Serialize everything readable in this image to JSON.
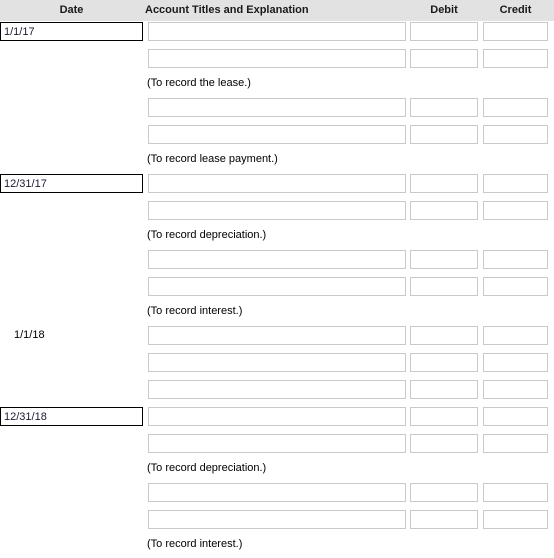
{
  "header": {
    "columns": [
      {
        "key": "date",
        "label": "Date"
      },
      {
        "key": "account",
        "label": "Account Titles and Explanation"
      },
      {
        "key": "debit",
        "label": "Debit"
      },
      {
        "key": "credit",
        "label": "Credit"
      }
    ],
    "background_color": "#e2e2e2"
  },
  "rows": [
    {
      "type": "entry",
      "date": "1/1/17",
      "date_style": "boxed",
      "account": "",
      "debit": "",
      "credit": ""
    },
    {
      "type": "entry",
      "date": "",
      "date_style": "none",
      "account": "",
      "debit": "",
      "credit": ""
    },
    {
      "type": "caption",
      "text": "(To record the lease.)"
    },
    {
      "type": "entry",
      "date": "",
      "date_style": "none",
      "account": "",
      "debit": "",
      "credit": ""
    },
    {
      "type": "entry",
      "date": "",
      "date_style": "none",
      "account": "",
      "debit": "",
      "credit": ""
    },
    {
      "type": "caption",
      "text": "(To record lease payment.)"
    },
    {
      "type": "entry",
      "date": "12/31/17",
      "date_style": "boxed",
      "account": "",
      "debit": "",
      "credit": ""
    },
    {
      "type": "entry",
      "date": "",
      "date_style": "none",
      "account": "",
      "debit": "",
      "credit": ""
    },
    {
      "type": "caption",
      "text": "(To record depreciation.)"
    },
    {
      "type": "entry",
      "date": "",
      "date_style": "none",
      "account": "",
      "debit": "",
      "credit": ""
    },
    {
      "type": "entry",
      "date": "",
      "date_style": "none",
      "account": "",
      "debit": "",
      "credit": ""
    },
    {
      "type": "caption",
      "text": "(To record interest.)"
    },
    {
      "type": "entry",
      "date": "1/1/18",
      "date_style": "plain",
      "account": "",
      "debit": "",
      "credit": ""
    },
    {
      "type": "entry",
      "date": "",
      "date_style": "none",
      "account": "",
      "debit": "",
      "credit": ""
    },
    {
      "type": "entry",
      "date": "",
      "date_style": "none",
      "account": "",
      "debit": "",
      "credit": ""
    },
    {
      "type": "entry",
      "date": "12/31/18",
      "date_style": "boxed",
      "account": "",
      "debit": "",
      "credit": ""
    },
    {
      "type": "entry",
      "date": "",
      "date_style": "none",
      "account": "",
      "debit": "",
      "credit": ""
    },
    {
      "type": "caption",
      "text": "(To record depreciation.)"
    },
    {
      "type": "entry",
      "date": "",
      "date_style": "none",
      "account": "",
      "debit": "",
      "credit": ""
    },
    {
      "type": "entry",
      "date": "",
      "date_style": "none",
      "account": "",
      "debit": "",
      "credit": ""
    },
    {
      "type": "caption",
      "text": "(To record interest.)"
    }
  ],
  "placeholders": {
    "date": "",
    "account": "",
    "debit": "",
    "credit": ""
  }
}
